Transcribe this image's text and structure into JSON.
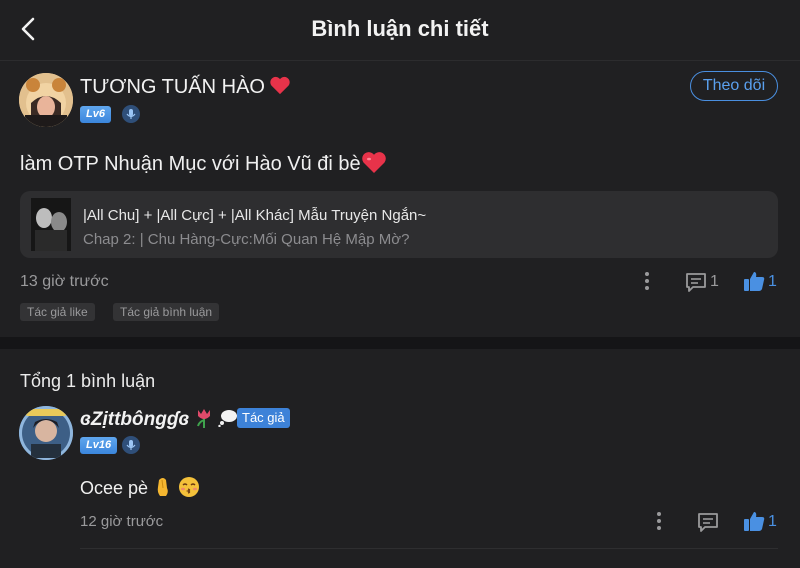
{
  "header": {
    "title": "Bình luận chi tiết",
    "back_icon": "chevron-left-icon"
  },
  "post": {
    "username": "TƯƠNG TUẤN HÀO",
    "level": "Lv6",
    "follow_label": "Theo dõi",
    "text": "làm OTP Nhuận Mục với Hào Vũ đi bè",
    "story": {
      "title": "|All Chu] + |All Cực] + |All Khác] Mẫu Truyện Ngắn~",
      "chapter": "Chap 2: | Chu Hàng-Cực:Mối Quan Hệ Mập Mờ?"
    },
    "time": "13 giờ trước",
    "reply_count": "1",
    "like_count": "1",
    "tags": [
      "Tác giả like",
      "Tác giả bình luận"
    ]
  },
  "replies_section": {
    "total_label": "Tổng 1 bình luận",
    "items": [
      {
        "username": "ɞZịttbôngɠɞ",
        "level": "Lv16",
        "author_badge": "Tác giả",
        "text": "Ocee pè",
        "time": "12 giờ trước",
        "like_count": "1"
      }
    ]
  },
  "colors": {
    "background": "#202022",
    "accent": "#4a90e2",
    "heart": "#e8334a"
  }
}
